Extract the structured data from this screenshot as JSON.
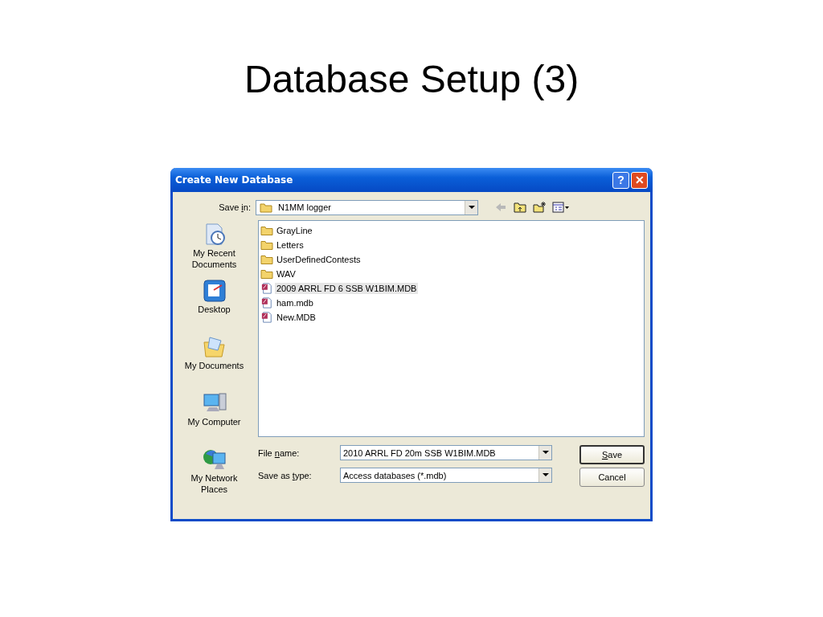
{
  "slide": {
    "title": "Database Setup (3)"
  },
  "dialog": {
    "title": "Create New Database",
    "title_buttons": [
      {
        "kind": "help",
        "label": "?"
      },
      {
        "kind": "close",
        "label": "✕"
      }
    ],
    "save_in": {
      "label_before": "Save ",
      "access_key": "i",
      "label_after": "n:",
      "value": "N1MM logger"
    },
    "places": [
      {
        "kind": "recent",
        "label": "My Recent Documents"
      },
      {
        "kind": "desktop",
        "label": "Desktop"
      },
      {
        "kind": "documents",
        "label": "My Documents"
      },
      {
        "kind": "computer",
        "label": "My Computer"
      },
      {
        "kind": "network",
        "label": "My Network Places"
      }
    ],
    "files": [
      {
        "kind": "folder",
        "name": "GrayLine",
        "selected": false
      },
      {
        "kind": "folder",
        "name": "Letters",
        "selected": false
      },
      {
        "kind": "folder",
        "name": "UserDefinedContests",
        "selected": false
      },
      {
        "kind": "folder",
        "name": "WAV",
        "selected": false
      },
      {
        "kind": "database",
        "name": "2009 ARRL FD 6 SSB W1BIM.MDB",
        "selected": true
      },
      {
        "kind": "database",
        "name": "ham.mdb",
        "selected": false
      },
      {
        "kind": "database",
        "name": "New.MDB",
        "selected": false
      }
    ],
    "file_name": {
      "label_before": "File ",
      "access_key": "n",
      "label_after": "ame:",
      "value": "2010 ARRL FD 20m SSB W1BIM.MDB"
    },
    "save_as_type": {
      "label_before": "Save as ",
      "access_key": "t",
      "label_after": "ype:",
      "value": "Access databases (*.mdb)"
    },
    "buttons": [
      {
        "access_key": "S",
        "label_after": "ave",
        "default": true
      },
      {
        "label_before": "Cancel",
        "default": false
      }
    ]
  }
}
